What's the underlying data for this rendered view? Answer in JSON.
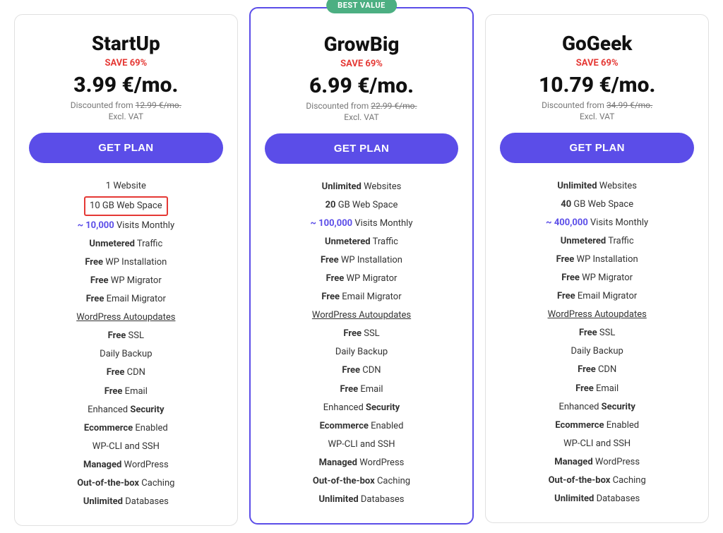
{
  "plans": [
    {
      "id": "startup",
      "name": "StartUp",
      "save": "SAVE 69%",
      "price": "3.99 €/mo.",
      "discounted_from": "12.99 €/mo.",
      "excl_vat": "Excl. VAT",
      "btn_label": "GET PLAN",
      "best_value": false,
      "features": [
        {
          "text": "1 Website",
          "bold_prefix": "",
          "bold_suffix": ""
        },
        {
          "text": "10 GB Web Space",
          "highlight_box": true
        },
        {
          "text": "~ 10,000 Visits Monthly",
          "highlight_visits": true,
          "prefix": "~ 10,000",
          "suffix": " Visits Monthly"
        },
        {
          "text": "Unmetered Traffic",
          "bold_prefix": "Unmetered"
        },
        {
          "text": "Free WP Installation",
          "bold_prefix": "Free"
        },
        {
          "text": "Free WP Migrator",
          "bold_prefix": "Free"
        },
        {
          "text": "Free Email Migrator",
          "bold_prefix": "Free"
        },
        {
          "text": "WordPress Autoupdates",
          "underline": true
        },
        {
          "text": "Free SSL",
          "bold_prefix": "Free"
        },
        {
          "text": "Daily Backup"
        },
        {
          "text": "Free CDN",
          "bold_prefix": "Free"
        },
        {
          "text": "Free Email",
          "bold_prefix": "Free"
        },
        {
          "text": "Enhanced Security",
          "bold_suffix": "Security",
          "prefix": "Enhanced "
        },
        {
          "text": "Ecommerce Enabled",
          "bold_prefix": "Ecommerce"
        },
        {
          "text": "WP-CLI and SSH"
        },
        {
          "text": "Managed WordPress",
          "bold_prefix": "Managed"
        },
        {
          "text": "Out-of-the-box Caching",
          "bold_prefix": "Out-of-the-box"
        },
        {
          "text": "Unlimited Databases",
          "bold_prefix": "Unlimited"
        }
      ]
    },
    {
      "id": "growbig",
      "name": "GrowBig",
      "save": "SAVE 69%",
      "price": "6.99 €/mo.",
      "discounted_from": "22.99 €/mo.",
      "excl_vat": "Excl. VAT",
      "btn_label": "GET PLAN",
      "best_value": true,
      "best_value_label": "BEST VALUE",
      "features": [
        {
          "text": "Unlimited Websites",
          "bold_prefix": "Unlimited"
        },
        {
          "text": "20 GB Web Space",
          "bold_prefix": "20"
        },
        {
          "text": "~ 100,000 Visits Monthly",
          "highlight_visits": true,
          "prefix": "~ 100,000",
          "suffix": " Visits Monthly"
        },
        {
          "text": "Unmetered Traffic",
          "bold_prefix": "Unmetered"
        },
        {
          "text": "Free WP Installation",
          "bold_prefix": "Free"
        },
        {
          "text": "Free WP Migrator",
          "bold_prefix": "Free"
        },
        {
          "text": "Free Email Migrator",
          "bold_prefix": "Free"
        },
        {
          "text": "WordPress Autoupdates",
          "underline": true
        },
        {
          "text": "Free SSL",
          "bold_prefix": "Free"
        },
        {
          "text": "Daily Backup"
        },
        {
          "text": "Free CDN",
          "bold_prefix": "Free"
        },
        {
          "text": "Free Email",
          "bold_prefix": "Free"
        },
        {
          "text": "Enhanced Security",
          "bold_suffix": "Security",
          "prefix": "Enhanced "
        },
        {
          "text": "Ecommerce Enabled",
          "bold_prefix": "Ecommerce"
        },
        {
          "text": "WP-CLI and SSH"
        },
        {
          "text": "Managed WordPress",
          "bold_prefix": "Managed"
        },
        {
          "text": "Out-of-the-box Caching",
          "bold_prefix": "Out-of-the-box"
        },
        {
          "text": "Unlimited Databases",
          "bold_prefix": "Unlimited"
        }
      ]
    },
    {
      "id": "gogeek",
      "name": "GoGeek",
      "save": "SAVE 69%",
      "price": "10.79 €/mo.",
      "discounted_from": "34.99 €/mo.",
      "excl_vat": "Excl. VAT",
      "btn_label": "GET PLAN",
      "best_value": false,
      "features": [
        {
          "text": "Unlimited Websites",
          "bold_prefix": "Unlimited"
        },
        {
          "text": "40 GB Web Space",
          "bold_prefix": "40"
        },
        {
          "text": "~ 400,000 Visits Monthly",
          "highlight_visits": true,
          "prefix": "~ 400,000",
          "suffix": " Visits Monthly"
        },
        {
          "text": "Unmetered Traffic",
          "bold_prefix": "Unmetered"
        },
        {
          "text": "Free WP Installation",
          "bold_prefix": "Free"
        },
        {
          "text": "Free WP Migrator",
          "bold_prefix": "Free"
        },
        {
          "text": "Free Email Migrator",
          "bold_prefix": "Free"
        },
        {
          "text": "WordPress Autoupdates",
          "underline": true
        },
        {
          "text": "Free SSL",
          "bold_prefix": "Free"
        },
        {
          "text": "Daily Backup"
        },
        {
          "text": "Free CDN",
          "bold_prefix": "Free"
        },
        {
          "text": "Free Email",
          "bold_prefix": "Free"
        },
        {
          "text": "Enhanced Security",
          "bold_suffix": "Security",
          "prefix": "Enhanced "
        },
        {
          "text": "Ecommerce Enabled",
          "bold_prefix": "Ecommerce"
        },
        {
          "text": "WP-CLI and SSH"
        },
        {
          "text": "Managed WordPress",
          "bold_prefix": "Managed"
        },
        {
          "text": "Out-of-the-box Caching",
          "bold_prefix": "Out-of-the-box"
        },
        {
          "text": "Unlimited Databases",
          "bold_prefix": "Unlimited"
        }
      ]
    }
  ]
}
